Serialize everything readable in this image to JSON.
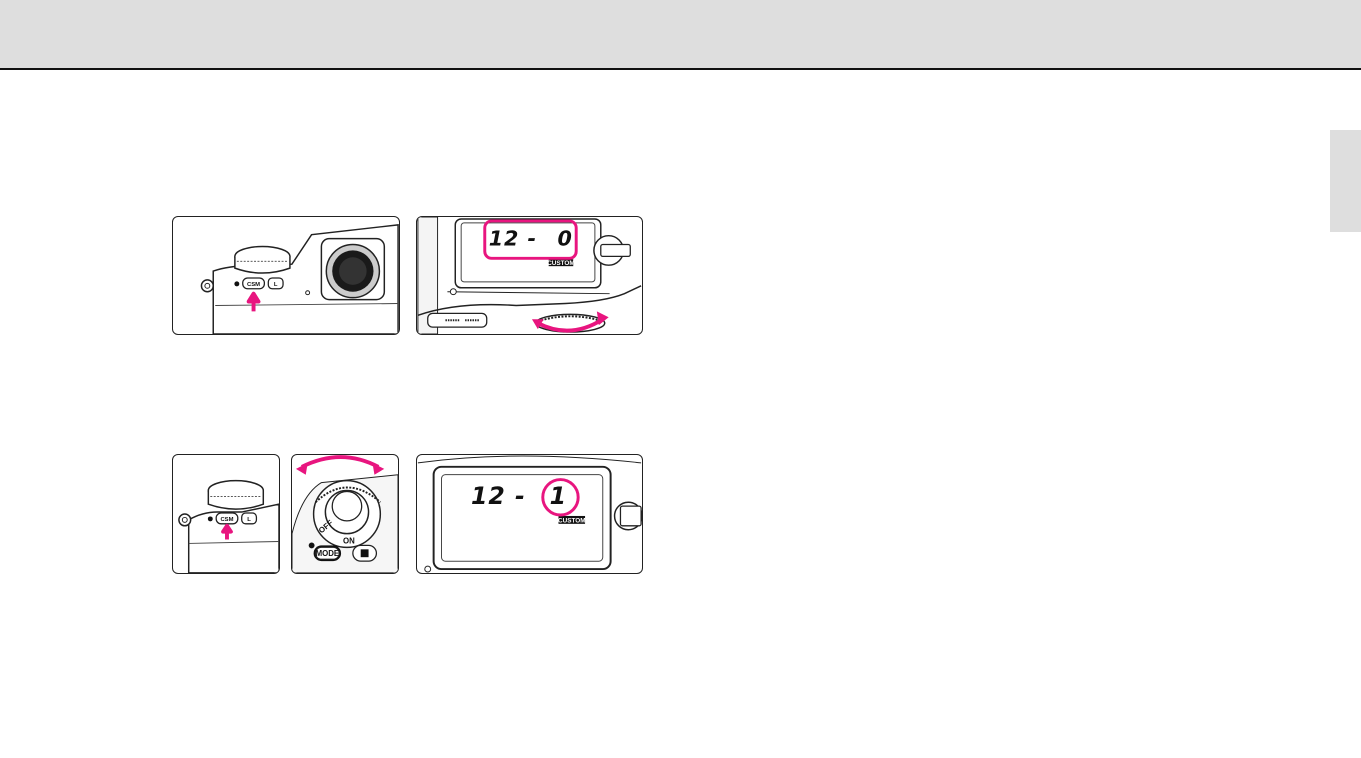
{
  "colors": {
    "accent": "#e8157f",
    "band": "#dedede",
    "line": "#222222"
  },
  "figures": {
    "step1": {
      "csm_label": "CSM",
      "lock_label": "L",
      "lcd_setting": "12 -",
      "lcd_value": "0",
      "lcd_custom": "CUSTOM"
    },
    "step2": {
      "csm_label": "CSM",
      "lock_label": "L",
      "switch_off": "OFF",
      "switch_on": "ON",
      "mode_label": "MODE",
      "lcd_setting": "12 -",
      "lcd_value": "1",
      "lcd_custom": "CUSTOM"
    }
  }
}
